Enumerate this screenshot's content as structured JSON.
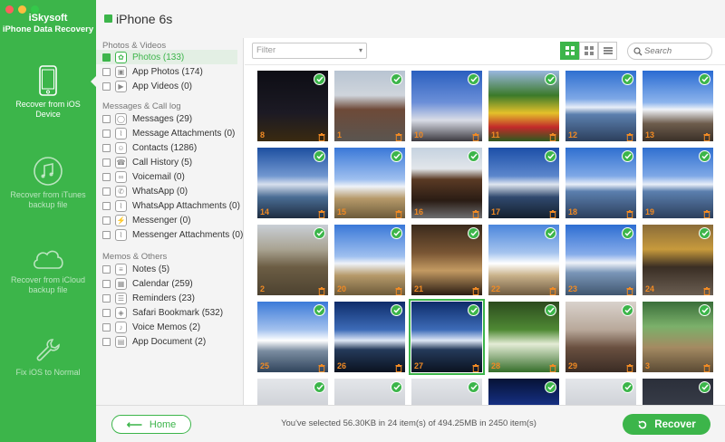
{
  "window": {
    "brand": "iSkysoft",
    "product": "iPhone Data Recovery"
  },
  "sidebar": {
    "modes": [
      {
        "label": "Recover from iOS Device",
        "icon": "iphone-icon",
        "active": true
      },
      {
        "label": "Recover from iTunes backup file",
        "icon": "music-note-icon",
        "active": false
      },
      {
        "label": "Recover from iCloud backup file",
        "icon": "cloud-icon",
        "active": false
      },
      {
        "label": "Fix iOS to Normal",
        "icon": "wrench-icon",
        "active": false
      }
    ]
  },
  "header": {
    "device": "iPhone 6s"
  },
  "categories": {
    "sections": [
      {
        "title": "Photos & Videos",
        "items": [
          {
            "label": "Photos (133)",
            "checked": true,
            "active": true,
            "icon": "flower-icon"
          },
          {
            "label": "App Photos (174)",
            "checked": false,
            "icon": "image-icon"
          },
          {
            "label": "App Videos (0)",
            "checked": false,
            "icon": "play-icon"
          }
        ]
      },
      {
        "title": "Messages & Call log",
        "items": [
          {
            "label": "Messages (29)",
            "checked": false,
            "icon": "chat-bubble-icon"
          },
          {
            "label": "Message Attachments (0)",
            "checked": false,
            "icon": "paperclip-icon"
          },
          {
            "label": "Contacts (1286)",
            "checked": false,
            "icon": "contact-card-icon"
          },
          {
            "label": "Call History (5)",
            "checked": false,
            "icon": "phone-icon"
          },
          {
            "label": "Voicemail (0)",
            "checked": false,
            "icon": "voicemail-icon"
          },
          {
            "label": "WhatsApp (0)",
            "checked": false,
            "icon": "whatsapp-icon"
          },
          {
            "label": "WhatsApp Attachments (0)",
            "checked": false,
            "icon": "paperclip-icon"
          },
          {
            "label": "Messenger (0)",
            "checked": false,
            "icon": "messenger-icon"
          },
          {
            "label": "Messenger Attachments (0)",
            "checked": false,
            "icon": "paperclip-icon"
          }
        ]
      },
      {
        "title": "Memos & Others",
        "items": [
          {
            "label": "Notes (5)",
            "checked": false,
            "icon": "notes-icon"
          },
          {
            "label": "Calendar (259)",
            "checked": false,
            "icon": "calendar-icon"
          },
          {
            "label": "Reminders (23)",
            "checked": false,
            "icon": "list-icon"
          },
          {
            "label": "Safari Bookmark (532)",
            "checked": false,
            "icon": "compass-icon"
          },
          {
            "label": "Voice Memos (2)",
            "checked": false,
            "icon": "microphone-icon"
          },
          {
            "label": "App Document (2)",
            "checked": false,
            "icon": "document-icon"
          }
        ]
      }
    ]
  },
  "toolbar": {
    "filter_placeholder": "Filter",
    "search_placeholder": "Search",
    "views": [
      "large-grid-icon",
      "small-grid-icon",
      "list-view-icon"
    ]
  },
  "photos": [
    {
      "num": "8",
      "theme": "night-tower"
    },
    {
      "num": "1",
      "theme": "city-building"
    },
    {
      "num": "10",
      "theme": "blossom-sky"
    },
    {
      "num": "11",
      "theme": "flower-bush"
    },
    {
      "num": "12",
      "theme": "mountain-lake"
    },
    {
      "num": "13",
      "theme": "mountain-sign"
    },
    {
      "num": "14",
      "theme": "mountain-sunset"
    },
    {
      "num": "15",
      "theme": "mountain-grass"
    },
    {
      "num": "16",
      "theme": "wooden-house"
    },
    {
      "num": "17",
      "theme": "mountain-blue"
    },
    {
      "num": "18",
      "theme": "mountain-lake"
    },
    {
      "num": "19",
      "theme": "mountain-lake"
    },
    {
      "num": "2",
      "theme": "valley-slope"
    },
    {
      "num": "20",
      "theme": "mountain-grass"
    },
    {
      "num": "21",
      "theme": "food-plate"
    },
    {
      "num": "22",
      "theme": "boats"
    },
    {
      "num": "23",
      "theme": "mountain-shore"
    },
    {
      "num": "24",
      "theme": "street-shops"
    },
    {
      "num": "25",
      "theme": "mountain-snow"
    },
    {
      "num": "26",
      "theme": "mountain-dark"
    },
    {
      "num": "27",
      "theme": "mountain-dark",
      "selected": true
    },
    {
      "num": "28",
      "theme": "garden-green"
    },
    {
      "num": "29",
      "theme": "bare-trees"
    },
    {
      "num": "3",
      "theme": "forest-path"
    },
    {
      "num": "",
      "theme": "winter-trees"
    },
    {
      "num": "",
      "theme": "winter-trees"
    },
    {
      "num": "",
      "theme": "winter-trees"
    },
    {
      "num": "",
      "theme": "night-blue"
    },
    {
      "num": "",
      "theme": "winter-trees"
    },
    {
      "num": "",
      "theme": "app-icons"
    }
  ],
  "footer": {
    "home_label": "Home",
    "status": "You've selected 56.30KB in 24 item(s) of 494.25MB in 2450 item(s)",
    "recover_label": "Recover"
  },
  "colors": {
    "accent": "#3cb54a",
    "photo_number": "#f08a24"
  }
}
